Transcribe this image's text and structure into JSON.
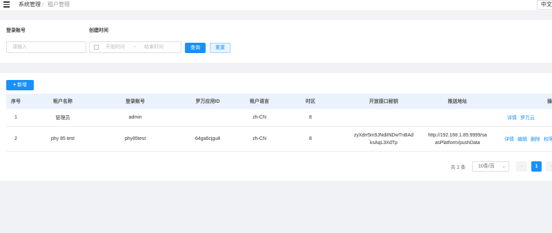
{
  "breadcrumb": {
    "item1": "系统管理",
    "separator": "/",
    "item2": "租户管理"
  },
  "lang": "中文",
  "search": {
    "account_label": "登录账号",
    "account_placeholder": "请输入",
    "date_label": "创建时间",
    "date_start_placeholder": "开始时间",
    "date_separator": "-",
    "date_end_placeholder": "结束时间",
    "search_button": "查询",
    "reset_button": "重置"
  },
  "toolbar": {
    "add_plus": "+",
    "add_label": "新增"
  },
  "table": {
    "headers": [
      "序号",
      "租户名称",
      "登录账号",
      "罗万应用ID",
      "租户语言",
      "时区",
      "开放接口秘钥",
      "推送地址",
      "操作"
    ],
    "rows": [
      {
        "index": "1",
        "name": "管理员",
        "account": "admin",
        "app_id": "",
        "language": "zh-CN",
        "timezone": "8",
        "secret": "",
        "push_url": "",
        "actions": [
          "详情",
          "罗万云"
        ]
      },
      {
        "index": "2",
        "name": "phy 85 test",
        "account": "phy85test",
        "app_id": "64ga6cjgu8",
        "language": "zh-CN",
        "timezone": "8",
        "secret_line1": "zyXdrr5m9JNdiINDwTnBAd",
        "secret_line2": "ksAqL3XdTp",
        "push_line1": "http://192.168.1.85:9999/sa",
        "push_line2": "asPlatform/pushData",
        "actions": [
          "详情",
          "编辑",
          "删除",
          "权限"
        ]
      }
    ]
  },
  "pagination": {
    "total": "共 2 条",
    "page_size": "10条/页",
    "current_page": "1",
    "prev": "‹",
    "next": "›"
  },
  "colors": {
    "primary": "#1890ff",
    "header_bg": "#eaf2fd",
    "page_bg": "#f0f2f5"
  }
}
